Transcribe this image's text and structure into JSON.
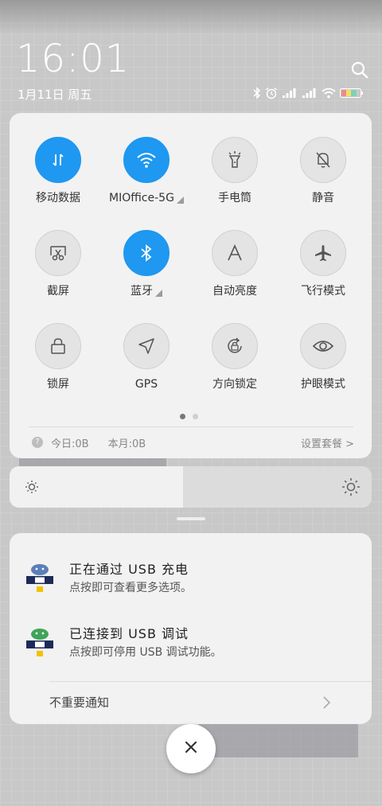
{
  "status_bar": {
    "time": "16:01",
    "date": "1月11日 周五",
    "icons": [
      "bluetooth-icon",
      "alarm-icon",
      "signal-icon",
      "signal-icon",
      "wifi-icon",
      "battery-icon"
    ]
  },
  "quick_settings": {
    "tiles": [
      {
        "label": "移动数据",
        "icon": "mobile-data-icon",
        "active": true
      },
      {
        "label": "MIOffice-5G",
        "icon": "wifi-icon",
        "active": true,
        "expandable": true
      },
      {
        "label": "手电筒",
        "icon": "flashlight-icon",
        "active": false
      },
      {
        "label": "静音",
        "icon": "silent-icon",
        "active": false
      },
      {
        "label": "截屏",
        "icon": "screenshot-icon",
        "active": false
      },
      {
        "label": "蓝牙",
        "icon": "bluetooth-icon",
        "active": true,
        "expandable": true
      },
      {
        "label": "自动亮度",
        "icon": "auto-brightness-icon",
        "active": false
      },
      {
        "label": "飞行模式",
        "icon": "airplane-icon",
        "active": false
      },
      {
        "label": "锁屏",
        "icon": "lock-icon",
        "active": false
      },
      {
        "label": "GPS",
        "icon": "gps-icon",
        "active": false
      },
      {
        "label": "方向锁定",
        "icon": "rotation-lock-icon",
        "active": false
      },
      {
        "label": "护眼模式",
        "icon": "eye-icon",
        "active": false
      }
    ],
    "page_count": 2,
    "current_page": 1,
    "usage": {
      "today": "今日:0B",
      "month": "本月:0B",
      "plan_link": "设置套餐 >"
    }
  },
  "brightness": {
    "level": 0.48
  },
  "notifications": [
    {
      "title": "正在通过 USB 充电",
      "subtitle": "点按即可查看更多选项。"
    },
    {
      "title": "已连接到 USB 调试",
      "subtitle": "点按即可停用 USB 调试功能。"
    }
  ],
  "unimportant_label": "不重要通知",
  "colors": {
    "accent": "#1e98f0",
    "panel": "#f2f2f2"
  }
}
